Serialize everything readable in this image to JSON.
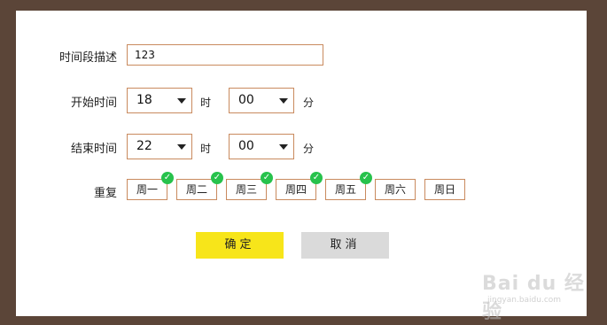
{
  "form": {
    "description_label": "时间段描述",
    "description_value": "123",
    "start_label": "开始时间",
    "start_hour": "18",
    "start_minute": "00",
    "end_label": "结束时间",
    "end_hour": "22",
    "end_minute": "00",
    "hour_unit": "时",
    "minute_unit": "分",
    "repeat_label": "重复",
    "days": [
      {
        "label": "周一",
        "checked": true
      },
      {
        "label": "周二",
        "checked": true
      },
      {
        "label": "周三",
        "checked": true
      },
      {
        "label": "周四",
        "checked": true
      },
      {
        "label": "周五",
        "checked": true
      },
      {
        "label": "周六",
        "checked": false
      },
      {
        "label": "周日",
        "checked": false
      }
    ],
    "check_glyph": "✓"
  },
  "buttons": {
    "confirm": "确定",
    "cancel": "取消"
  },
  "watermark": {
    "main": "Bai du 经验",
    "sub": "jingyan.baidu.com"
  },
  "colors": {
    "border": "#c98a5e",
    "confirm_bg": "#f7e51a",
    "cancel_bg": "#dadada",
    "check": "#27c24c"
  }
}
